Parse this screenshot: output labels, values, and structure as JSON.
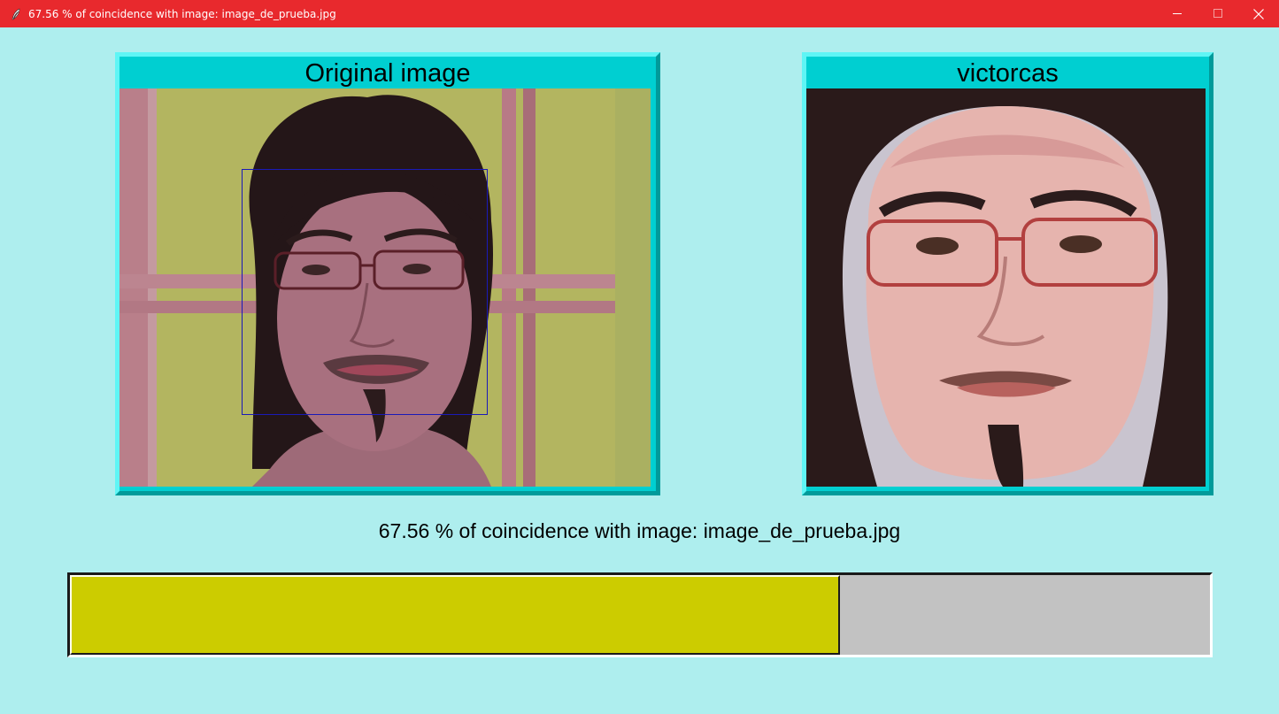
{
  "window": {
    "title": "67.56 % of coincidence with image: image_de_prueba.jpg",
    "icon": "feather-icon",
    "controls": [
      "minimize-icon",
      "maximize-icon",
      "close-icon"
    ],
    "titlebar_color": "#e8292d"
  },
  "panels": {
    "original": {
      "title": "Original image",
      "image": "webcam-photo-face",
      "face_detected": true
    },
    "match": {
      "title": "victorcas",
      "image": "matched-face-photo"
    }
  },
  "result": {
    "text": "67.56 % of coincidence with image: image_de_prueba.jpg",
    "coincidence_percent": 67.56
  },
  "colors": {
    "background": "#aeeeee",
    "panel_header": "#00cfd1",
    "progress_fill": "#cccc00",
    "progress_track": "#c2c2c2"
  }
}
